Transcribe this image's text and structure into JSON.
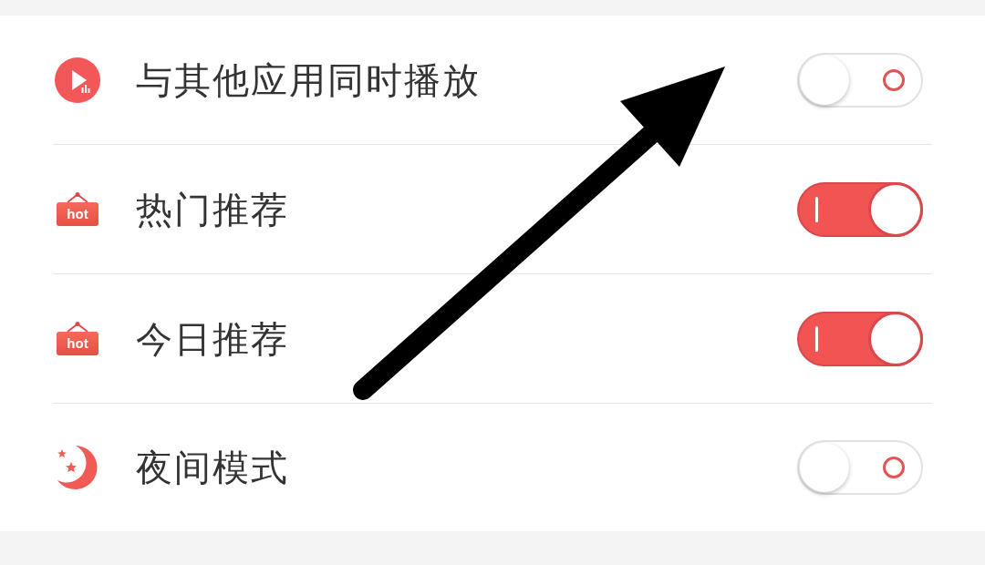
{
  "settings": [
    {
      "kind": "play",
      "label": "与其他应用同时播放",
      "on": false
    },
    {
      "kind": "hot",
      "sign_text": "hot",
      "label": "热门推荐",
      "on": true
    },
    {
      "kind": "hot",
      "sign_text": "hot",
      "label": "今日推荐",
      "on": true
    },
    {
      "kind": "moon",
      "label": "夜间模式",
      "on": false
    }
  ]
}
